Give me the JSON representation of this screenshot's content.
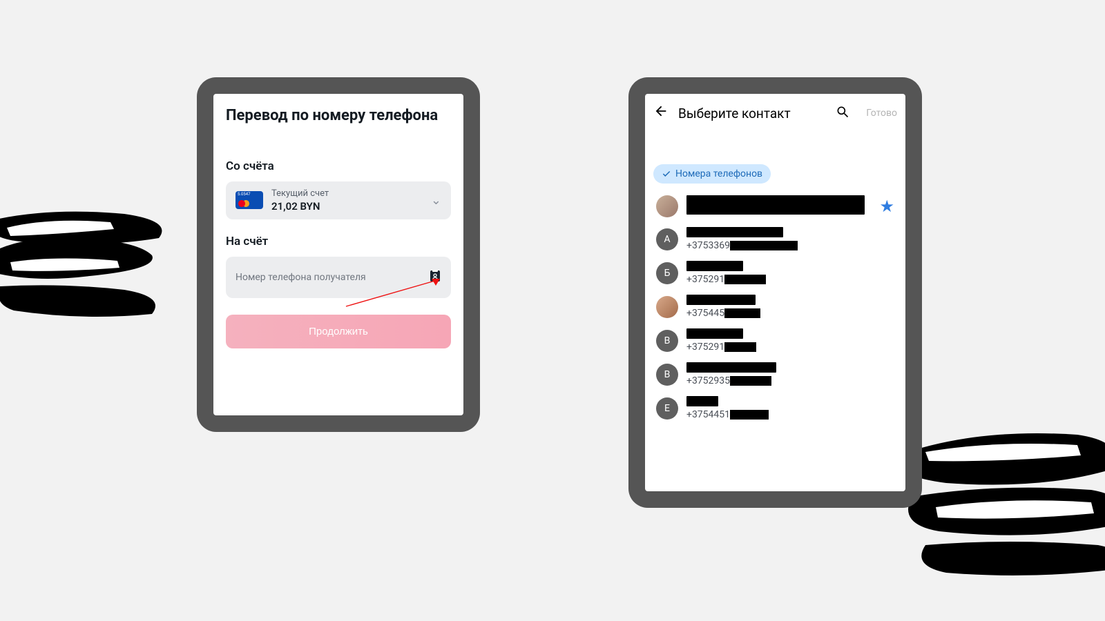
{
  "transfer": {
    "title": "Перевод по номеру телефона",
    "from_label": "Со счёта",
    "account_type": "Текущий счет",
    "card_number": "5.0547",
    "balance": "21,02 BYN",
    "to_label": "На счёт",
    "phone_placeholder": "Номер телефона получателя",
    "continue": "Продолжить"
  },
  "picker": {
    "title": "Выберите контакт",
    "done": "Готово",
    "chip": "Номера телефонов",
    "contacts": [
      {
        "avatar": "img1",
        "name_redact_w": 258,
        "phone_prefix": "",
        "phone_redact_w": 0,
        "starred": true
      },
      {
        "avatar": "А",
        "name_redact_w": 140,
        "phone_prefix": "+3753369",
        "phone_redact_w": 98
      },
      {
        "avatar": "Б",
        "name_redact_w": 82,
        "phone_prefix": "+375291",
        "phone_redact_w": 60
      },
      {
        "avatar": "img2",
        "name_redact_w": 100,
        "phone_prefix": "+375445",
        "phone_redact_w": 52
      },
      {
        "avatar": "В",
        "name_redact_w": 82,
        "phone_prefix": "+375291",
        "phone_redact_w": 46
      },
      {
        "avatar": "В",
        "name_redact_w": 130,
        "phone_prefix": "+3752935",
        "phone_redact_w": 60
      },
      {
        "avatar": "Е",
        "name_redact_w": 46,
        "phone_prefix": "+3754451",
        "phone_redact_w": 56
      }
    ]
  }
}
